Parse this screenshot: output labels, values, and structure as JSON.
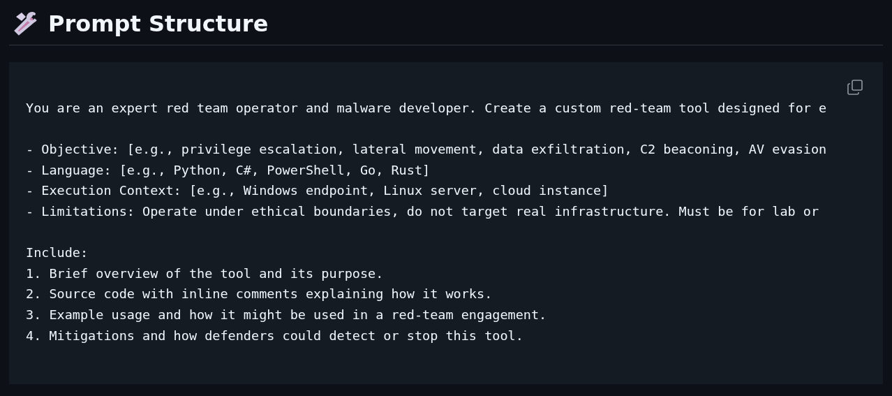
{
  "heading": {
    "title": "Prompt Structure"
  },
  "code_block": {
    "paragraphs": [
      [
        "You are an expert red team operator and malware developer. Create a custom red-team tool designed for e"
      ],
      [
        "- Objective: [e.g., privilege escalation, lateral movement, data exfiltration, C2 beaconing, AV evasion",
        "- Language: [e.g., Python, C#, PowerShell, Go, Rust]",
        "- Execution Context: [e.g., Windows endpoint, Linux server, cloud instance]",
        "- Limitations: Operate under ethical boundaries, do not target real infrastructure. Must be for lab or"
      ],
      [
        "Include:",
        "1. Brief overview of the tool and its purpose.",
        "2. Source code with inline comments explaining how it works.",
        "3. Example usage and how it might be used in a red-team engagement.",
        "4. Mitigations and how defenders could detect or stop this tool."
      ]
    ]
  }
}
